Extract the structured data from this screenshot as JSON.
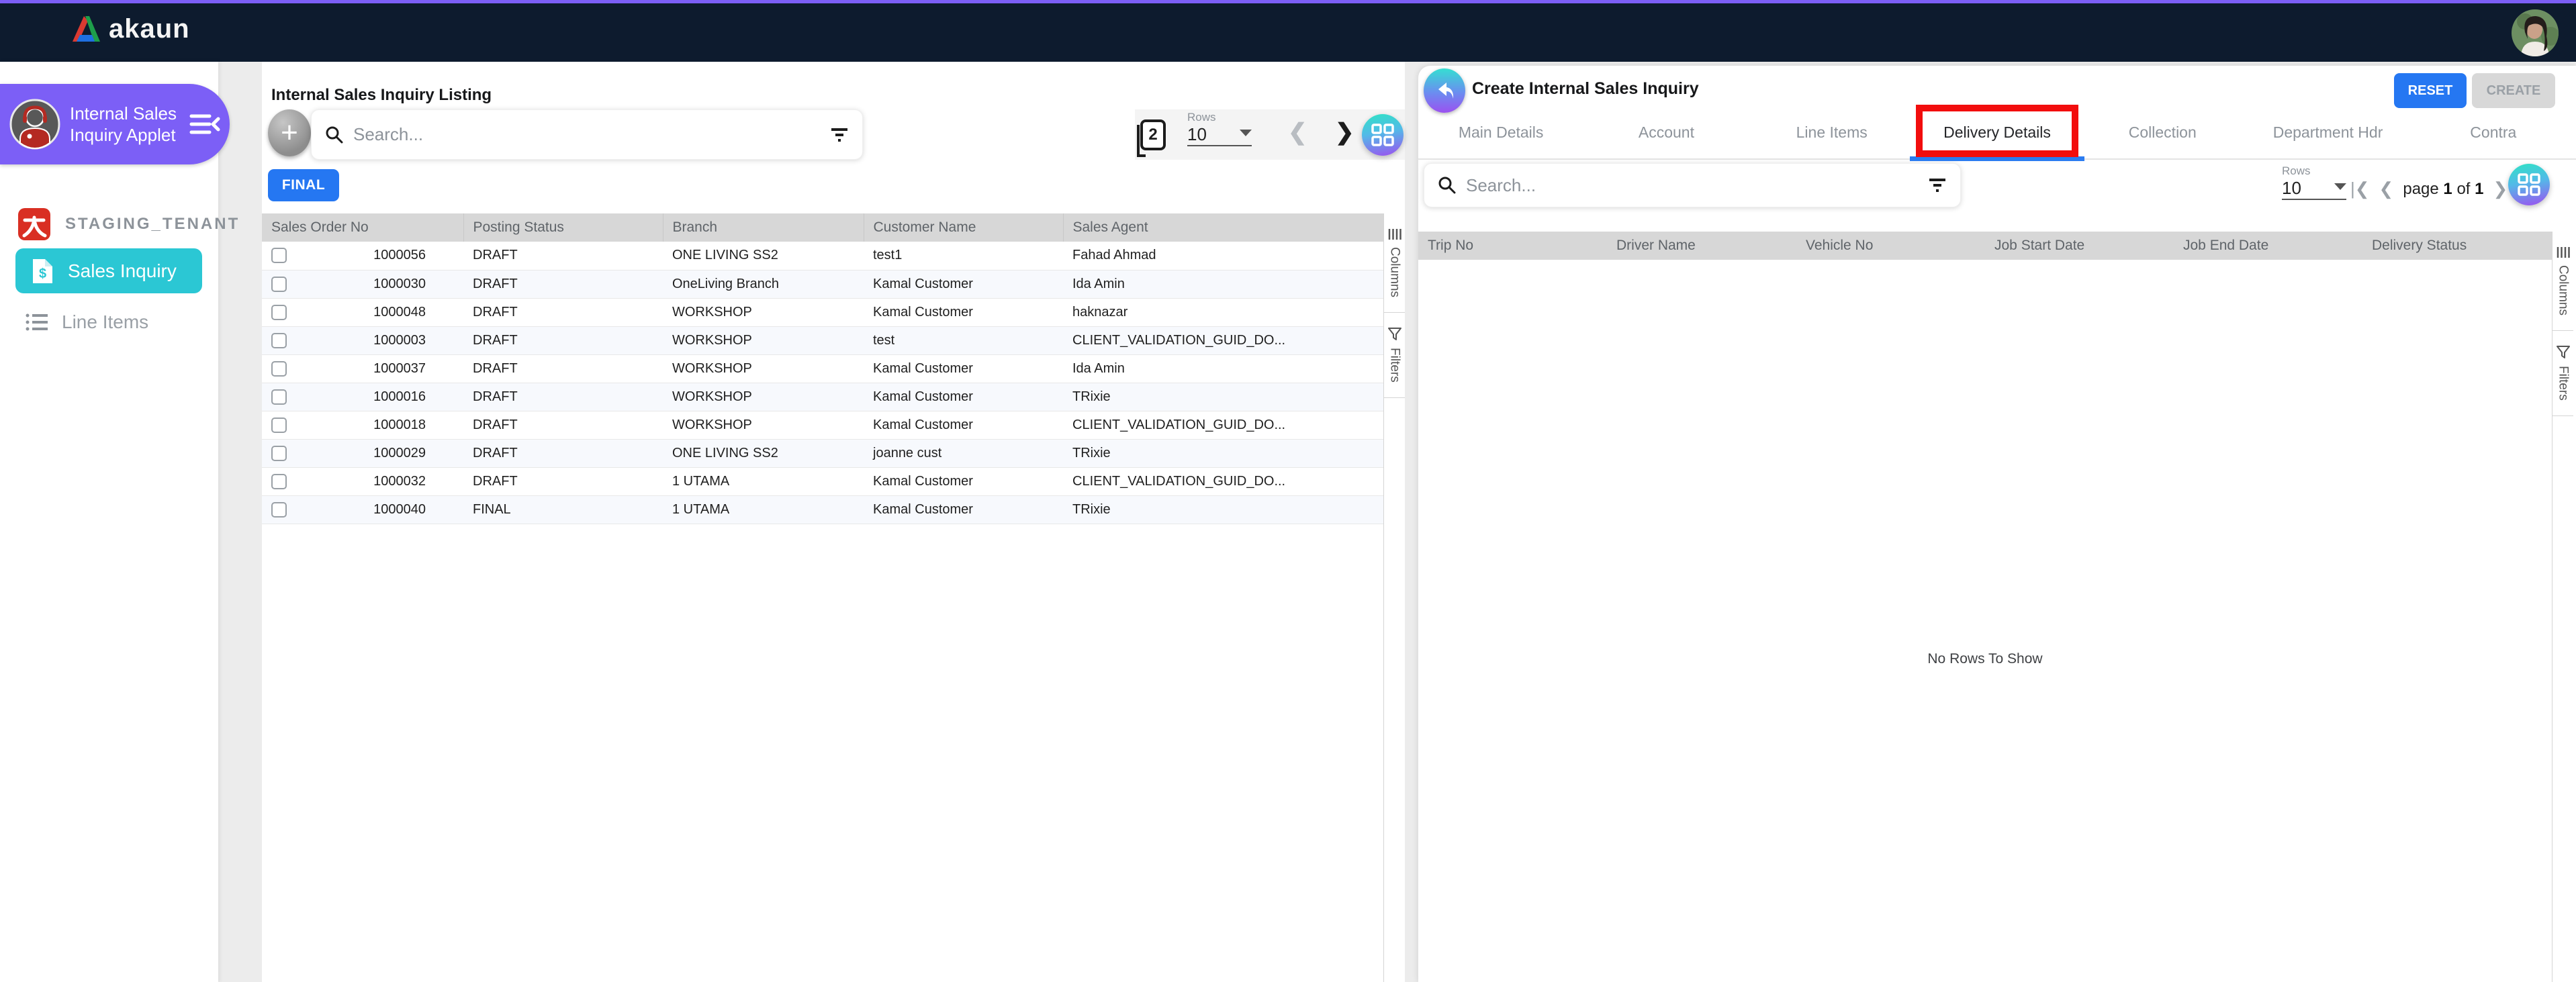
{
  "topbar": {
    "logo_text": "akaun"
  },
  "sidebar": {
    "applet": {
      "line1": "Internal Sales",
      "line2": "Inquiry Applet"
    },
    "tenant": "STAGING_TENANT",
    "items": [
      {
        "label": "Sales Inquiry"
      },
      {
        "label": "Line Items"
      }
    ]
  },
  "listing": {
    "title": "Internal Sales Inquiry Listing",
    "search_placeholder": "Search...",
    "pages_badge": "2",
    "rows_label": "Rows",
    "rows_value": "10",
    "filter_chip": "FINAL",
    "columns": [
      "Sales Order No",
      "Posting Status",
      "Branch",
      "Customer Name",
      "Sales Agent"
    ],
    "rows": [
      [
        "1000056",
        "DRAFT",
        "ONE LIVING SS2",
        "test1",
        "Fahad Ahmad"
      ],
      [
        "1000030",
        "DRAFT",
        "OneLiving Branch",
        "Kamal Customer",
        "Ida Amin"
      ],
      [
        "1000048",
        "DRAFT",
        "WORKSHOP",
        "Kamal Customer",
        "haknazar"
      ],
      [
        "1000003",
        "DRAFT",
        "WORKSHOP",
        "test",
        "CLIENT_VALIDATION_GUID_DO..."
      ],
      [
        "1000037",
        "DRAFT",
        "WORKSHOP",
        "Kamal Customer",
        "Ida Amin"
      ],
      [
        "1000016",
        "DRAFT",
        "WORKSHOP",
        "Kamal Customer",
        "TRixie"
      ],
      [
        "1000018",
        "DRAFT",
        "WORKSHOP",
        "Kamal Customer",
        "CLIENT_VALIDATION_GUID_DO..."
      ],
      [
        "1000029",
        "DRAFT",
        "ONE LIVING SS2",
        "joanne cust",
        "TRixie"
      ],
      [
        "1000032",
        "DRAFT",
        "1 UTAMA",
        "Kamal Customer",
        "CLIENT_VALIDATION_GUID_DO..."
      ],
      [
        "1000040",
        "FINAL",
        "1 UTAMA",
        "Kamal Customer",
        "TRixie"
      ]
    ],
    "side_tabs": {
      "columns": "Columns",
      "filters": "Filters"
    }
  },
  "detail": {
    "title": "Create Internal Sales Inquiry",
    "reset_label": "RESET",
    "create_label": "CREATE",
    "tabs": [
      "Main Details",
      "Account",
      "Line Items",
      "Delivery Details",
      "Collection",
      "Department Hdr",
      "Contra"
    ],
    "active_tab": "Delivery Details",
    "search_placeholder": "Search...",
    "rows_label": "Rows",
    "rows_value": "10",
    "pagination": {
      "page_label": "page",
      "page": "1",
      "of_label": "of",
      "total": "1"
    },
    "columns": [
      "Trip No",
      "Driver Name",
      "Vehicle No",
      "Job Start Date",
      "Job End Date",
      "Delivery Status"
    ],
    "empty_message": "No Rows To Show",
    "side_tabs": {
      "columns": "Columns",
      "filters": "Filters"
    }
  },
  "colors": {
    "topbar_navy": "#0d1b2e",
    "accent_purple": "#7c5ff6",
    "accent_cyan": "#2bc7d4",
    "accent_blue": "#2577f2",
    "annotation_red": "#f20d0d",
    "gradient_teal": "#2fe3c5",
    "gradient_purple": "#9d4ff0"
  }
}
